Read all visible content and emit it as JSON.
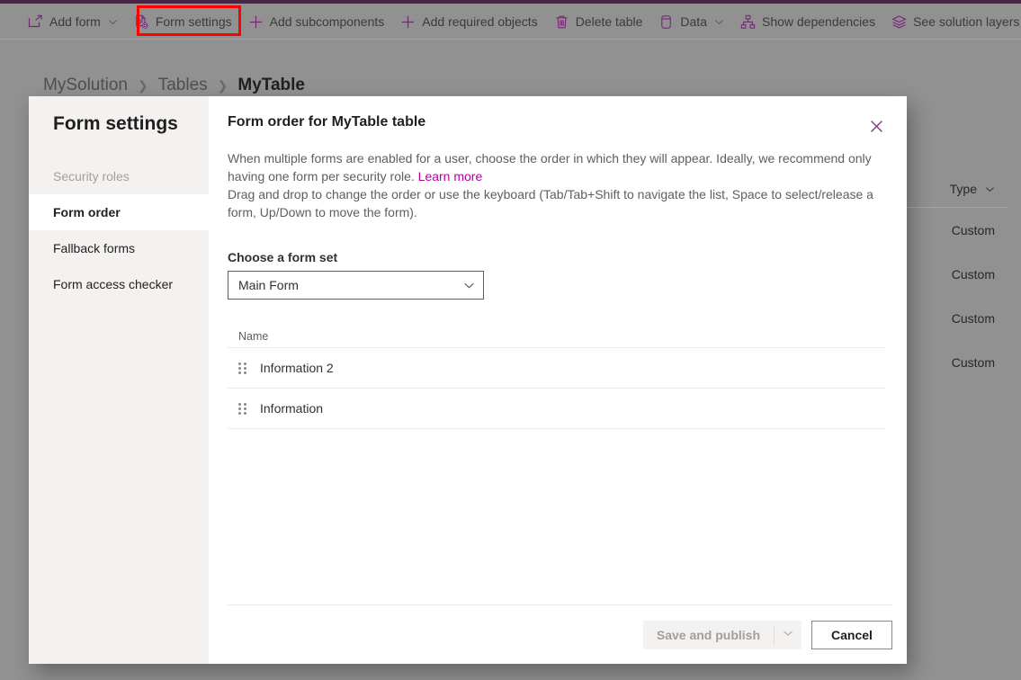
{
  "colors": {
    "accent_purple": "#4a2545",
    "icon_purple": "#742774",
    "link_magenta": "#b4009e",
    "highlight_red": "#ff0000",
    "backdrop_grey": "#919191",
    "nav_grey": "#f3f2f1"
  },
  "command_bar": {
    "items": [
      {
        "icon": "add-form-icon",
        "label": "Add form",
        "has_chevron": true
      },
      {
        "icon": "form-settings-icon",
        "label": "Form settings",
        "has_chevron": false,
        "highlighted": true
      },
      {
        "icon": "plus-icon",
        "label": "Add subcomponents",
        "has_chevron": false
      },
      {
        "icon": "plus-icon",
        "label": "Add required objects",
        "has_chevron": false
      },
      {
        "icon": "trash-icon",
        "label": "Delete table",
        "has_chevron": false
      },
      {
        "icon": "database-icon",
        "label": "Data",
        "has_chevron": true
      },
      {
        "icon": "dependencies-icon",
        "label": "Show dependencies",
        "has_chevron": false
      },
      {
        "icon": "layers-icon",
        "label": "See solution layers",
        "has_chevron": false
      }
    ]
  },
  "breadcrumb": {
    "items": [
      {
        "label": "MySolution",
        "current": false
      },
      {
        "label": "Tables",
        "current": false
      },
      {
        "label": "MyTable",
        "current": true
      }
    ],
    "separator": "❯"
  },
  "background_grid": {
    "column_header": "Type",
    "header_icon": "chevron-down-icon",
    "rows": [
      "Custom",
      "Custom",
      "Custom",
      "Custom"
    ]
  },
  "dialog": {
    "title": "Form settings",
    "close_icon": "close-icon",
    "nav_items": [
      {
        "label": "Security roles",
        "state": "disabled"
      },
      {
        "label": "Form order",
        "state": "selected"
      },
      {
        "label": "Fallback forms",
        "state": "normal"
      },
      {
        "label": "Form access checker",
        "state": "normal"
      }
    ],
    "panel": {
      "heading": "Form order for MyTable table",
      "description_part1": "When multiple forms are enabled for a user, choose the order in which they will appear. Ideally, we recommend only having one form per security role. ",
      "description_link": "Learn more",
      "description_part2": "Drag and drop to change the order or use the keyboard (Tab/Tab+Shift to navigate the list, Space to select/release a form, Up/Down to move the form).",
      "formset_label": "Choose a form set",
      "formset_value": "Main Form",
      "formset_options": [
        "Main Form"
      ],
      "formset_chevron_icon": "chevron-down-icon",
      "list_header": "Name",
      "forms": [
        {
          "name": "Information 2",
          "handle_icon": "drag-handle-icon"
        },
        {
          "name": "Information",
          "handle_icon": "drag-handle-icon"
        }
      ]
    },
    "footer": {
      "save_label": "Save and publish",
      "save_disabled": true,
      "save_chevron_icon": "chevron-down-icon",
      "cancel_label": "Cancel"
    }
  }
}
